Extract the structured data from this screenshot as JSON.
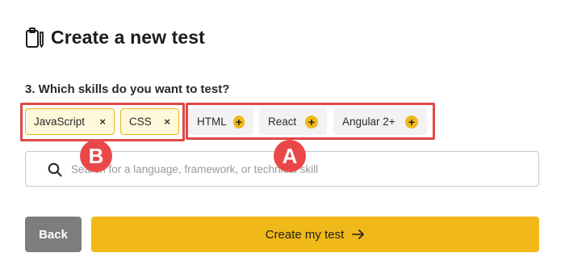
{
  "header": {
    "icon": "clipboard-icon",
    "title": "Create a new test"
  },
  "question": {
    "label": "3. Which skills do you want to test?"
  },
  "selected_skills": [
    {
      "label": "JavaScript",
      "action_icon": "×"
    },
    {
      "label": "CSS",
      "action_icon": "×"
    }
  ],
  "suggested_skills": [
    {
      "label": "HTML",
      "action_icon": "+"
    },
    {
      "label": "React",
      "action_icon": "+"
    },
    {
      "label": "Angular 2+",
      "action_icon": "+"
    }
  ],
  "search": {
    "placeholder": "Search for a language, framework, or technical skill",
    "value": ""
  },
  "annotations": {
    "marker_a": "A",
    "marker_b": "B"
  },
  "actions": {
    "back_label": "Back",
    "create_label": "Create my test"
  },
  "colors": {
    "accent": "#f0b818",
    "selected_chip_bg": "#fff8da",
    "annotation_red": "#e04848",
    "back_button": "#7d7d7d"
  }
}
